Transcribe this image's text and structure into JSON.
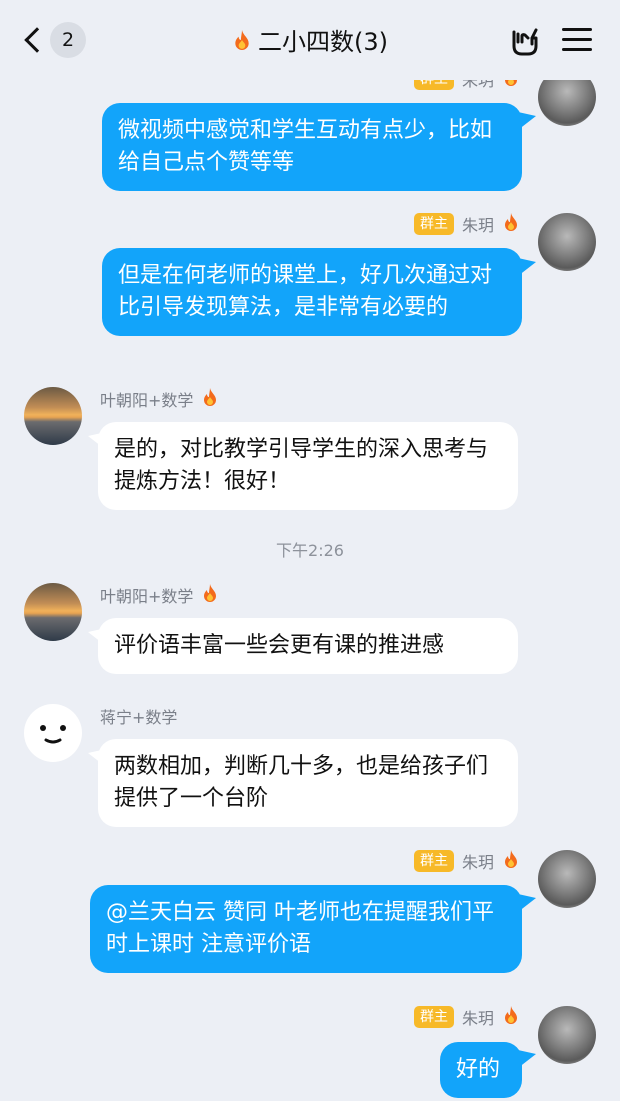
{
  "header": {
    "back_count": "2",
    "title": "二小四数(3)"
  },
  "messages": [
    {
      "sender": "朱玥",
      "role_tag": "群主",
      "text": "微视频中感觉和学生互动有点少，比如给自己点个赞等等"
    },
    {
      "sender": "朱玥",
      "role_tag": "群主",
      "text": "但是在何老师的课堂上，好几次通过对比引导发现算法，是非常有必要的"
    },
    {
      "sender": "叶朝阳+数学",
      "text": "是的，对比教学引导学生的深入思考与提炼方法！很好！"
    },
    {
      "time": "下午2:26"
    },
    {
      "sender": "叶朝阳+数学",
      "text": "评价语丰富一些会更有课的推进感"
    },
    {
      "sender": "蒋宁+数学",
      "text": "两数相加，判断几十多，也是给孩子们提供了一个台阶"
    },
    {
      "sender": "朱玥",
      "role_tag": "群主",
      "text": "@兰天白云 赞同 叶老师也在提醒我们平时上课时 注意评价语"
    },
    {
      "sender": "朱玥",
      "role_tag": "群主",
      "text": "好的"
    }
  ],
  "colors": {
    "outgoing_bubble": "#12a4fa",
    "incoming_bubble": "#ffffff",
    "owner_tag": "#f7b928",
    "background": "#eceff5"
  }
}
